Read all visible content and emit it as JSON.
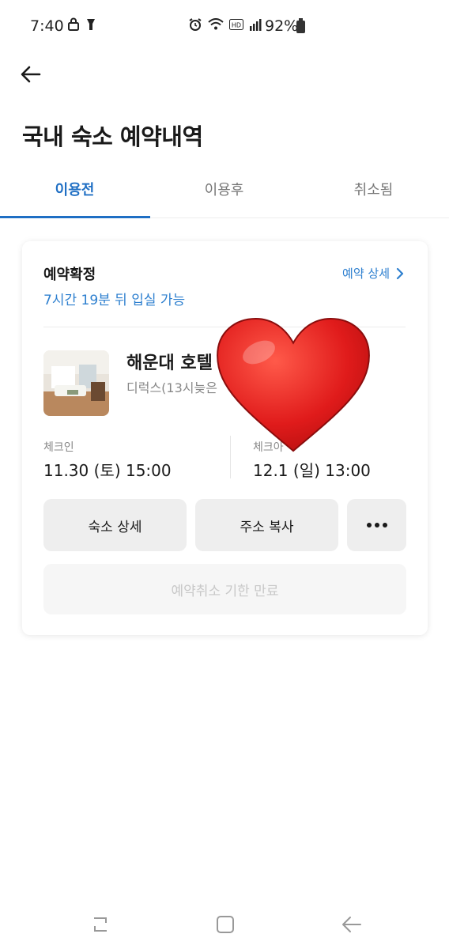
{
  "status_bar": {
    "time": "7:40",
    "battery_percent": "92%",
    "icons": [
      "lock-icon",
      "flashlight-icon",
      "alarm-icon",
      "wifi-icon",
      "hd-icon",
      "signal-icon",
      "battery-icon"
    ]
  },
  "header": {
    "back_icon": "arrow-left-icon",
    "title": "국내 숙소 예약내역"
  },
  "tabs": [
    {
      "label": "이용전",
      "active": true
    },
    {
      "label": "이용후",
      "active": false
    },
    {
      "label": "취소됨",
      "active": false
    }
  ],
  "reservation": {
    "status": "예약확정",
    "countdown": "7시간 19분 뒤 입실 가능",
    "detail_link": "예약 상세",
    "hotel_name": "해운대 호텔",
    "room_type": "디럭스(13시늦은",
    "checkin_label": "체크인",
    "checkin_value": "11.30 (토) 15:00",
    "checkout_label": "체크아",
    "checkout_value": "12.1 (일) 13:00",
    "buttons": {
      "stay_detail": "숙소 상세",
      "copy_address": "주소 복사",
      "more_icon": "more-icon"
    },
    "cancel_notice": "예약취소 기한 만료"
  },
  "overlay": {
    "sticker": "heart-icon",
    "color": "#e01b1b"
  },
  "colors": {
    "accent": "#1f6fc4",
    "link": "#2d7fcf"
  },
  "nav_bar": [
    "recents-icon",
    "home-icon",
    "back-icon"
  ]
}
